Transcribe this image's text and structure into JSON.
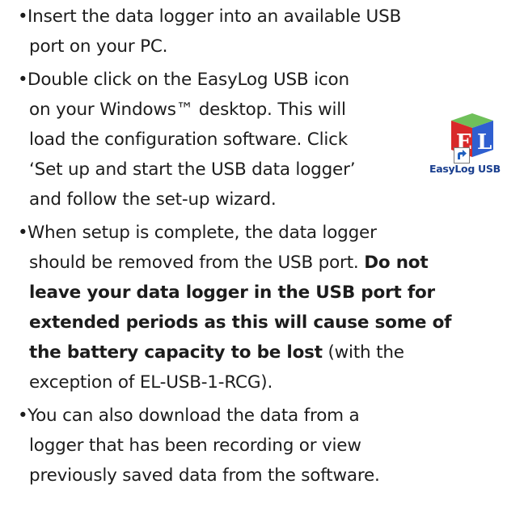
{
  "bullet_glyph": "•",
  "items": [
    {
      "lines": [
        "Insert the data logger into an available USB",
        "port on your PC."
      ]
    },
    {
      "lines": [
        "Double click on the EasyLog USB icon",
        "on your Windows™ desktop. This will",
        "load the configuration software. Click",
        "‘Set up and start the USB data logger’",
        "and follow the set-up wizard."
      ]
    },
    {
      "line1_plain": "When setup is complete, the data logger",
      "line2_plain": "should be removed from the USB port. ",
      "line2_bold": "Do not",
      "line3_bold": "leave your data logger in the USB port for",
      "line4_bold": "extended periods as this will cause some of",
      "line5_bold": "the battery capacity to be lost",
      "line5_plain": " (with the",
      "line6_plain": "exception of EL-USB-1-RCG)."
    },
    {
      "lines": [
        "You can also download the data from a",
        "logger that has been recording or view",
        "previously saved data from the software."
      ]
    }
  ],
  "desktop_icon": {
    "letters": "EL",
    "caption": "EasyLog USB",
    "colors": {
      "top": "#6fc05a",
      "left": "#d8292a",
      "right": "#2f5fd0",
      "letters": "#ffffff",
      "caption": "#1a3f8f"
    }
  }
}
